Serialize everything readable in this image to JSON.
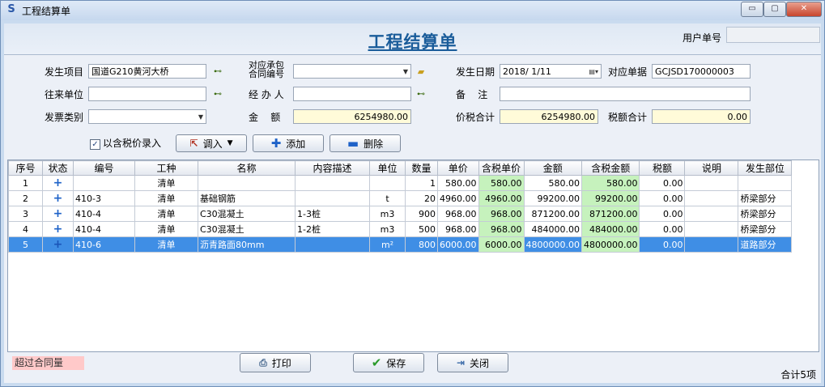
{
  "window": {
    "title": "工程结算单",
    "min": "▭",
    "max": "▢",
    "close": "✕"
  },
  "header": {
    "form_title": "工程结算单",
    "user_no_label": "用户单号",
    "user_no_value": ""
  },
  "form": {
    "project_label": "发生项目",
    "project_value": "国道G210黄河大桥",
    "contract_label_1": "对应承包",
    "contract_label_2": "合同编号",
    "contract_value": "",
    "date_label": "发生日期",
    "date_value": "2018/ 1/11",
    "doc_label": "对应单据",
    "doc_value": "GCJSD170000003",
    "partner_label": "往来单位",
    "partner_value": "",
    "handler_label": "经 办 人",
    "handler_value": "",
    "remark_label": "备    注",
    "remark_value": "",
    "invoice_label": "发票类别",
    "invoice_value": "",
    "amount_label": "金    额",
    "amount_value": "6254980.00",
    "taxed_total_label": "价税合计",
    "taxed_total_value": "6254980.00",
    "tax_total_label": "税额合计",
    "tax_total_value": "0.00"
  },
  "toolbar": {
    "tax_checkbox_label": "以含税价录入",
    "tax_checkbox_checked": true,
    "import_label": "调入",
    "add_label": "添加",
    "delete_label": "删除"
  },
  "table": {
    "headers": [
      "序号",
      "状态",
      "编号",
      "工种",
      "名称",
      "内容描述",
      "单位",
      "数量",
      "单价",
      "含税单价",
      "金额",
      "含税金额",
      "税额",
      "说明",
      "发生部位"
    ],
    "rows": [
      [
        "1",
        "+",
        "",
        "清单",
        "",
        "",
        "",
        "1",
        "580.00",
        "580.00",
        "580.00",
        "580.00",
        "0.00",
        "",
        ""
      ],
      [
        "2",
        "+",
        "410-3",
        "清单",
        "基础钢筋",
        "",
        "t",
        "20",
        "4960.00",
        "4960.00",
        "99200.00",
        "99200.00",
        "0.00",
        "",
        "桥梁部分"
      ],
      [
        "3",
        "+",
        "410-4",
        "清单",
        "C30混凝土",
        "1-3桩",
        "m3",
        "900",
        "968.00",
        "968.00",
        "871200.00",
        "871200.00",
        "0.00",
        "",
        "桥梁部分"
      ],
      [
        "4",
        "+",
        "410-4",
        "清单",
        "C30混凝土",
        "1-2桩",
        "m3",
        "500",
        "968.00",
        "968.00",
        "484000.00",
        "484000.00",
        "0.00",
        "",
        "桥梁部分"
      ],
      [
        "5",
        "+",
        "410-6",
        "清单",
        "沥青路面80mm",
        "",
        "m²",
        "800",
        "6000.00",
        "6000.00",
        "4800000.00",
        "4800000.00",
        "0.00",
        "",
        "道路部分"
      ]
    ],
    "selected_row": 4
  },
  "footer": {
    "print_label": "打印",
    "save_label": "保存",
    "close_label": "关闭",
    "exceed_label": "超过合同量",
    "total_label": "合计5项"
  },
  "colors": {
    "accent": "#1a5c9a",
    "selected": "#3f8ee5",
    "taxed_cell": "#c6f2bd",
    "amount_field": "#fffbd9",
    "exceed": "#ffc9c9"
  }
}
